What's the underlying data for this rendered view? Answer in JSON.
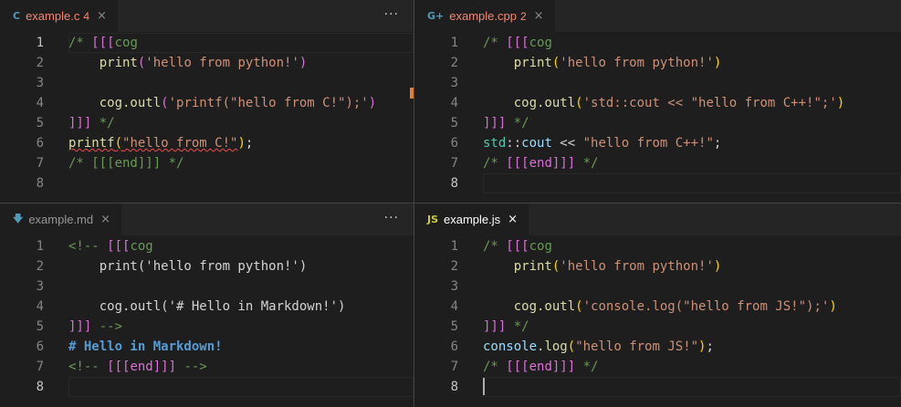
{
  "panes": [
    {
      "tab": {
        "icon_text": "C",
        "icon_color": "#519aba",
        "name": "example.c",
        "count": "4",
        "name_color": "#f48771",
        "close": "×",
        "italic": false
      },
      "more": "···",
      "active_line": 1,
      "lines": [
        [
          {
            "t": "/* ",
            "c": "cm"
          },
          {
            "t": "[[[",
            "c": "br1"
          },
          {
            "t": "cog",
            "c": "cm"
          }
        ],
        [
          {
            "t": "    print",
            "c": "fn"
          },
          {
            "t": "(",
            "c": "br1"
          },
          {
            "t": "'hello from python!'",
            "c": "str"
          },
          {
            "t": ")",
            "c": "br1"
          }
        ],
        [],
        [
          {
            "t": "    cog.outl",
            "c": "fn"
          },
          {
            "t": "(",
            "c": "br1"
          },
          {
            "t": "'printf(\"hello from C!\");'",
            "c": "str"
          },
          {
            "t": ")",
            "c": "br1"
          }
        ],
        [
          {
            "t": "]]]",
            "c": "br1"
          },
          {
            "t": " */",
            "c": "cm"
          }
        ],
        [
          {
            "t": "printf",
            "c": "fn",
            "s": 1
          },
          {
            "t": "(",
            "c": "br2",
            "s": 1
          },
          {
            "t": "\"hello from C!\"",
            "c": "str",
            "s": 1
          },
          {
            "t": ")",
            "c": "br2"
          },
          {
            "t": ";",
            "c": "op"
          }
        ],
        [
          {
            "t": "/* [[[end]]] */",
            "c": "cm"
          }
        ],
        []
      ]
    },
    {
      "tab": {
        "icon_text": "G+",
        "icon_color": "#519aba",
        "name": "example.cpp",
        "count": "2",
        "name_color": "#f48771",
        "close": "×",
        "italic": false
      },
      "more": "",
      "active_line": 8,
      "lines": [
        [
          {
            "t": "/* ",
            "c": "cm"
          },
          {
            "t": "[[[",
            "c": "br1"
          },
          {
            "t": "cog",
            "c": "cm"
          }
        ],
        [
          {
            "t": "    print",
            "c": "fn"
          },
          {
            "t": "(",
            "c": "br2"
          },
          {
            "t": "'hello from python!'",
            "c": "str"
          },
          {
            "t": ")",
            "c": "br2"
          }
        ],
        [],
        [
          {
            "t": "    cog.outl",
            "c": "fn"
          },
          {
            "t": "(",
            "c": "br2"
          },
          {
            "t": "'std::cout << \"hello from C++!\";'",
            "c": "str"
          },
          {
            "t": ")",
            "c": "br2"
          }
        ],
        [
          {
            "t": "]]]",
            "c": "br1"
          },
          {
            "t": " */",
            "c": "cm"
          }
        ],
        [
          {
            "t": "std",
            "c": "ns"
          },
          {
            "t": "::",
            "c": "op"
          },
          {
            "t": "cout",
            "c": "id"
          },
          {
            "t": " << ",
            "c": "op"
          },
          {
            "t": "\"hello from C++!\"",
            "c": "str"
          },
          {
            "t": ";",
            "c": "op"
          }
        ],
        [
          {
            "t": "/* ",
            "c": "cm"
          },
          {
            "t": "[[[end]]]",
            "c": "br1"
          },
          {
            "t": " */",
            "c": "cm"
          }
        ],
        []
      ]
    },
    {
      "tab": {
        "icon_text": "🡇",
        "icon_color": "#519aba",
        "name": "example.md",
        "count": "",
        "name_color": "#969696",
        "close": "×",
        "italic": false
      },
      "more": "···",
      "active_line": 8,
      "lines": [
        [
          {
            "t": "<!-- ",
            "c": "cm"
          },
          {
            "t": "[[[",
            "c": "br1"
          },
          {
            "t": "cog",
            "c": "cm"
          }
        ],
        [
          {
            "t": "    print('hello from python!')",
            "c": "op"
          }
        ],
        [],
        [
          {
            "t": "    cog.outl('# Hello in Markdown!')",
            "c": "op"
          }
        ],
        [
          {
            "t": "]]]",
            "c": "br1"
          },
          {
            "t": " -->",
            "c": "cm"
          }
        ],
        [
          {
            "t": "# Hello in Markdown!",
            "c": "hd"
          }
        ],
        [
          {
            "t": "<!-- ",
            "c": "cm"
          },
          {
            "t": "[[[end]]]",
            "c": "br1"
          },
          {
            "t": " -->",
            "c": "cm"
          }
        ],
        []
      ]
    },
    {
      "tab": {
        "icon_text": "JS",
        "icon_color": "#cbcb41",
        "name": "example.js",
        "count": "",
        "name_color": "#ffffff",
        "close": "×",
        "italic": false
      },
      "more": "",
      "active_line": 8,
      "lines": [
        [
          {
            "t": "/* ",
            "c": "cm"
          },
          {
            "t": "[[[",
            "c": "br1"
          },
          {
            "t": "cog",
            "c": "cm"
          }
        ],
        [
          {
            "t": "    print",
            "c": "fn"
          },
          {
            "t": "(",
            "c": "br2"
          },
          {
            "t": "'hello from python!'",
            "c": "str"
          },
          {
            "t": ")",
            "c": "br2"
          }
        ],
        [],
        [
          {
            "t": "    cog.outl",
            "c": "fn"
          },
          {
            "t": "(",
            "c": "br2"
          },
          {
            "t": "'console.log(\"hello from JS!\");'",
            "c": "str"
          },
          {
            "t": ")",
            "c": "br2"
          }
        ],
        [
          {
            "t": "]]]",
            "c": "br1"
          },
          {
            "t": " */",
            "c": "cm"
          }
        ],
        [
          {
            "t": "console",
            "c": "id"
          },
          {
            "t": ".",
            "c": "op"
          },
          {
            "t": "log",
            "c": "fn"
          },
          {
            "t": "(",
            "c": "br2"
          },
          {
            "t": "\"hello from JS!\"",
            "c": "str"
          },
          {
            "t": ")",
            "c": "br2"
          },
          {
            "t": ";",
            "c": "op"
          }
        ],
        [
          {
            "t": "/* ",
            "c": "cm"
          },
          {
            "t": "[[[end]]]",
            "c": "br1"
          },
          {
            "t": " */",
            "c": "cm"
          }
        ],
        []
      ]
    }
  ]
}
